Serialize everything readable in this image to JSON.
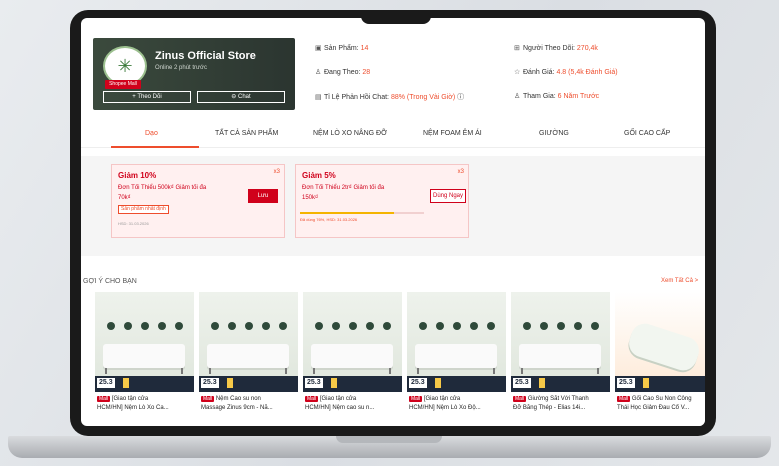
{
  "store": {
    "name": "Zinus Official Store",
    "status": "Online 2 phút trước",
    "mall_badge": "Shopee Mall",
    "follow_label": "+ Theo Dõi",
    "chat_label": "Chat"
  },
  "stats": {
    "products_label": "Sản Phẩm: ",
    "products_value": "14",
    "following_label": "Đang Theo: ",
    "following_value": "28",
    "response_label": "Tỉ Lệ Phản Hồi Chat: ",
    "response_value": "88% (Trong Vài Giờ)",
    "followers_label": "Người Theo Dõi: ",
    "followers_value": "270,4k",
    "rating_label": "Đánh Giá: ",
    "rating_value": "4.8 (5,4k Đánh Giá)",
    "joined_label": "Tham Gia: ",
    "joined_value": "6 Năm Trước"
  },
  "tabs": [
    "Dạo",
    "TẤT CẢ SẢN PHẨM",
    "NỆM LÒ XO NÂNG ĐỠ",
    "NỆM FOAM ÊM ÁI",
    "GIƯỜNG",
    "GỐI CAO CẤP"
  ],
  "vouchers": [
    {
      "title": "Giảm 10%",
      "desc1": "Đơn Tối Thiểu 500k₫ Giảm tối đa",
      "desc2": "70k₫",
      "tag": "Sản phẩm nhất định",
      "hsd": "HSD: 31.03.2026",
      "qty": "x3",
      "button": "Lưu"
    },
    {
      "title": "Giảm 5%",
      "desc1": "Đơn Tối Thiểu 2tr₫ Giảm tối đa",
      "desc2": "150k₫",
      "used": "Đã dùng 76%, HSD: 31.03.2026",
      "used_percent": 76,
      "qty": "x3",
      "button": "Dùng Ngay"
    }
  ],
  "recommend": {
    "title": "GỢI Ý CHO BẠN",
    "see_all": "Xem Tất Cả >",
    "products": [
      {
        "date": "25.3",
        "mall": "Mall",
        "line1": "[Giao tận cửa",
        "line2": "HCM/HN] Nệm Lò Xo Ca..."
      },
      {
        "date": "25.3",
        "mall": "Mall",
        "line1": "Nệm Cao su non",
        "line2": "Massage Zinus 9cm - Nằ..."
      },
      {
        "date": "25.3",
        "mall": "Mall",
        "line1": "[Giao tận cửa",
        "line2": "HCM/HN] Nệm cao su n..."
      },
      {
        "date": "25.3",
        "mall": "Mall",
        "line1": "[Giao tận cửa",
        "line2": "HCM/HN] Nệm Lò Xo Độ..."
      },
      {
        "date": "25.3",
        "mall": "Mall",
        "line1": "Giường Sắt Với Thanh",
        "line2": "Đỡ Bằng Thép - Elias 14i..."
      },
      {
        "date": "25.3",
        "mall": "Mall",
        "line1": "Gối Cao Su Non Công",
        "line2": "Thái Học Giảm Đau Cổ V..."
      }
    ]
  },
  "colors": {
    "accent": "#ee4d2d",
    "mall": "#d0011b"
  }
}
